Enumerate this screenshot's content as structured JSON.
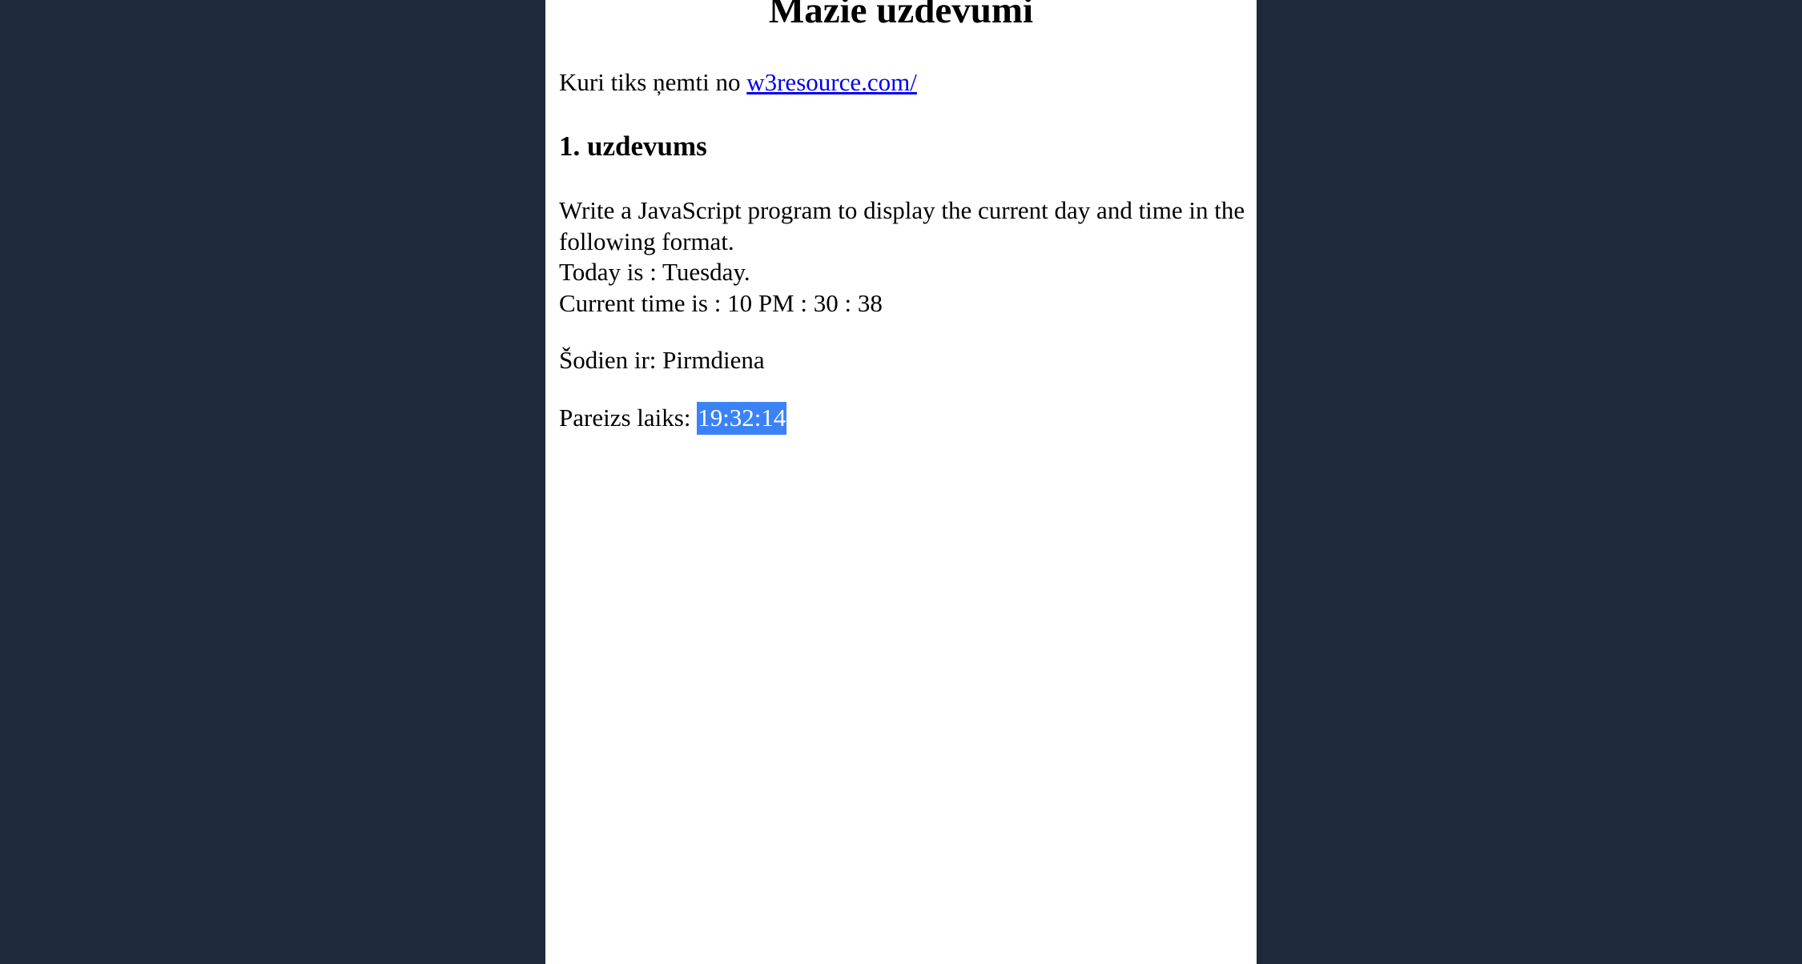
{
  "page": {
    "title": "Mazie uzdevumi",
    "source_prefix": "Kuri tiks ņemti no ",
    "source_link": "w3resource.com/"
  },
  "task1": {
    "heading": "1. uzdevums",
    "description_line1": "Write a JavaScript program to display the current day and time in the following format.",
    "description_line2": "Today is : Tuesday.",
    "description_line3": "Current time is : 10 PM : 30 : 38",
    "today_label": "Šodien ir: ",
    "today_value": "Pirmdiena",
    "time_label": "Pareizs laiks: ",
    "time_value": "19:32:14"
  },
  "colors": {
    "background": "#1e293b",
    "page": "#ffffff",
    "link": "#0000ee",
    "selection": "#3b82f6"
  }
}
